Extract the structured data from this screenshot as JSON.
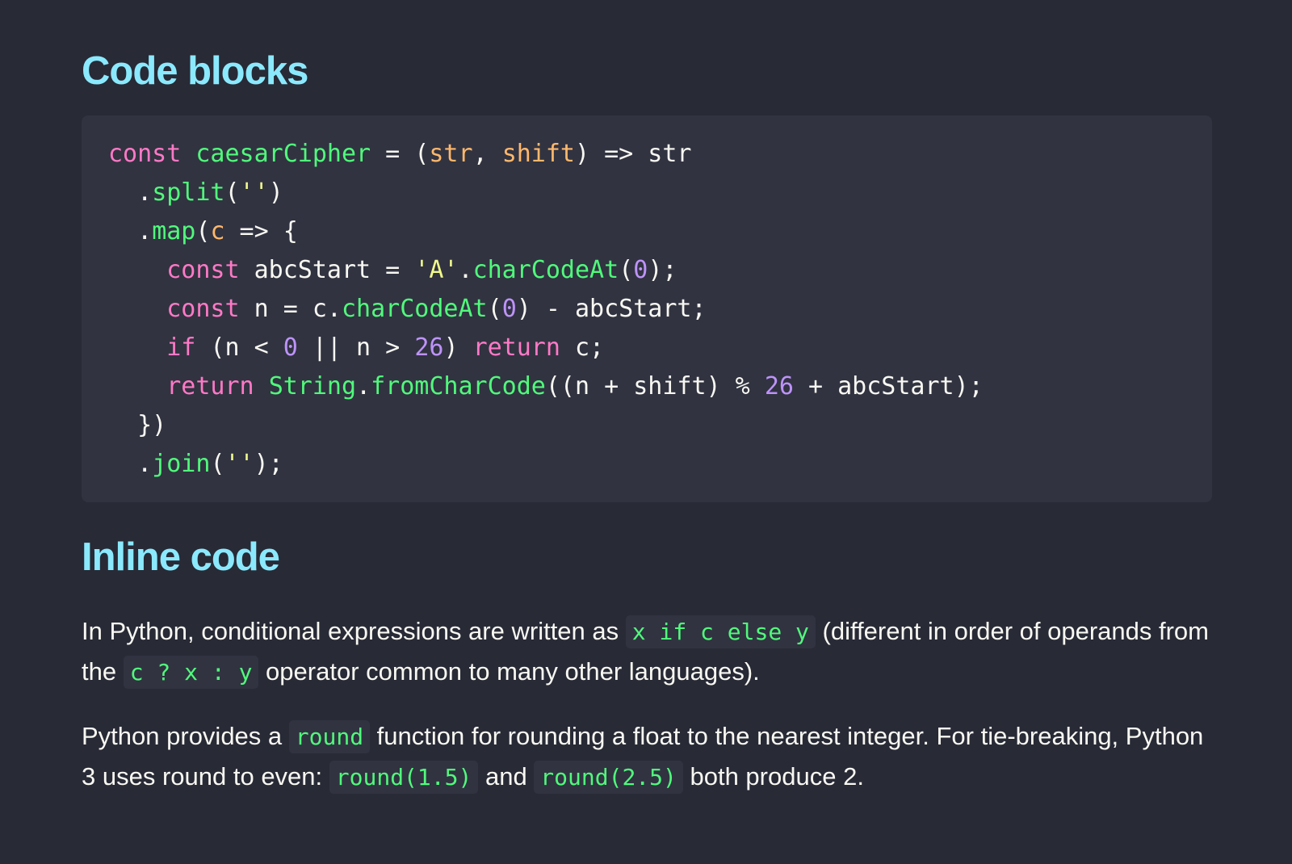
{
  "headings": {
    "code_blocks": "Code blocks",
    "inline_code": "Inline code"
  },
  "code_block": {
    "lines": [
      [
        [
          "kw",
          "const"
        ],
        [
          "pl",
          " "
        ],
        [
          "fn",
          "caesarCipher"
        ],
        [
          "pl",
          " = ("
        ],
        [
          "pa",
          "str"
        ],
        [
          "pl",
          ", "
        ],
        [
          "pa",
          "shift"
        ],
        [
          "pl",
          ") => str"
        ]
      ],
      [
        [
          "pl",
          "  ."
        ],
        [
          "fn",
          "split"
        ],
        [
          "pl",
          "("
        ],
        [
          "st",
          "''"
        ],
        [
          "pl",
          ")"
        ]
      ],
      [
        [
          "pl",
          "  ."
        ],
        [
          "fn",
          "map"
        ],
        [
          "pl",
          "("
        ],
        [
          "pa",
          "c"
        ],
        [
          "pl",
          " => {"
        ]
      ],
      [
        [
          "pl",
          "    "
        ],
        [
          "kw",
          "const"
        ],
        [
          "pl",
          " abcStart = "
        ],
        [
          "st",
          "'A'"
        ],
        [
          "pl",
          "."
        ],
        [
          "fn",
          "charCodeAt"
        ],
        [
          "pl",
          "("
        ],
        [
          "nu",
          "0"
        ],
        [
          "pl",
          ");"
        ]
      ],
      [
        [
          "pl",
          "    "
        ],
        [
          "kw",
          "const"
        ],
        [
          "pl",
          " n = c."
        ],
        [
          "fn",
          "charCodeAt"
        ],
        [
          "pl",
          "("
        ],
        [
          "nu",
          "0"
        ],
        [
          "pl",
          ") - abcStart;"
        ]
      ],
      [
        [
          "pl",
          "    "
        ],
        [
          "kw",
          "if"
        ],
        [
          "pl",
          " (n < "
        ],
        [
          "nu",
          "0"
        ],
        [
          "pl",
          " || n > "
        ],
        [
          "nu",
          "26"
        ],
        [
          "pl",
          ") "
        ],
        [
          "kw",
          "return"
        ],
        [
          "pl",
          " c;"
        ]
      ],
      [
        [
          "pl",
          "    "
        ],
        [
          "kw",
          "return"
        ],
        [
          "pl",
          " "
        ],
        [
          "fn",
          "String"
        ],
        [
          "pl",
          "."
        ],
        [
          "fn",
          "fromCharCode"
        ],
        [
          "pl",
          "((n + shift) % "
        ],
        [
          "nu",
          "26"
        ],
        [
          "pl",
          " + abcStart);"
        ]
      ],
      [
        [
          "pl",
          "  })"
        ]
      ],
      [
        [
          "pl",
          "  ."
        ],
        [
          "fn",
          "join"
        ],
        [
          "pl",
          "("
        ],
        [
          "st",
          "''"
        ],
        [
          "pl",
          ");"
        ]
      ]
    ]
  },
  "paragraph_1": {
    "t1": "In Python, conditional expressions are written as ",
    "c1": "x if c else y",
    "t2": " (different in order of operands from the ",
    "c2": "c ? x : y",
    "t3": " operator common to many other languages)."
  },
  "paragraph_2": {
    "t1": "Python provides a ",
    "c1": "round",
    "t2": " function for rounding a float to the nearest integer. For tie-breaking, Python 3 uses round to even: ",
    "c2": "round(1.5)",
    "t3": " and ",
    "c3": "round(2.5)",
    "t4": " both produce 2."
  },
  "colors": {
    "background": "#282a36",
    "code_background": "#313341",
    "heading": "#8be9fd",
    "keyword": "#ff79c6",
    "function": "#50fa7b",
    "param": "#ffb86c",
    "string": "#f1fa8c",
    "number": "#bd93f9",
    "text": "#f8f8f2"
  }
}
